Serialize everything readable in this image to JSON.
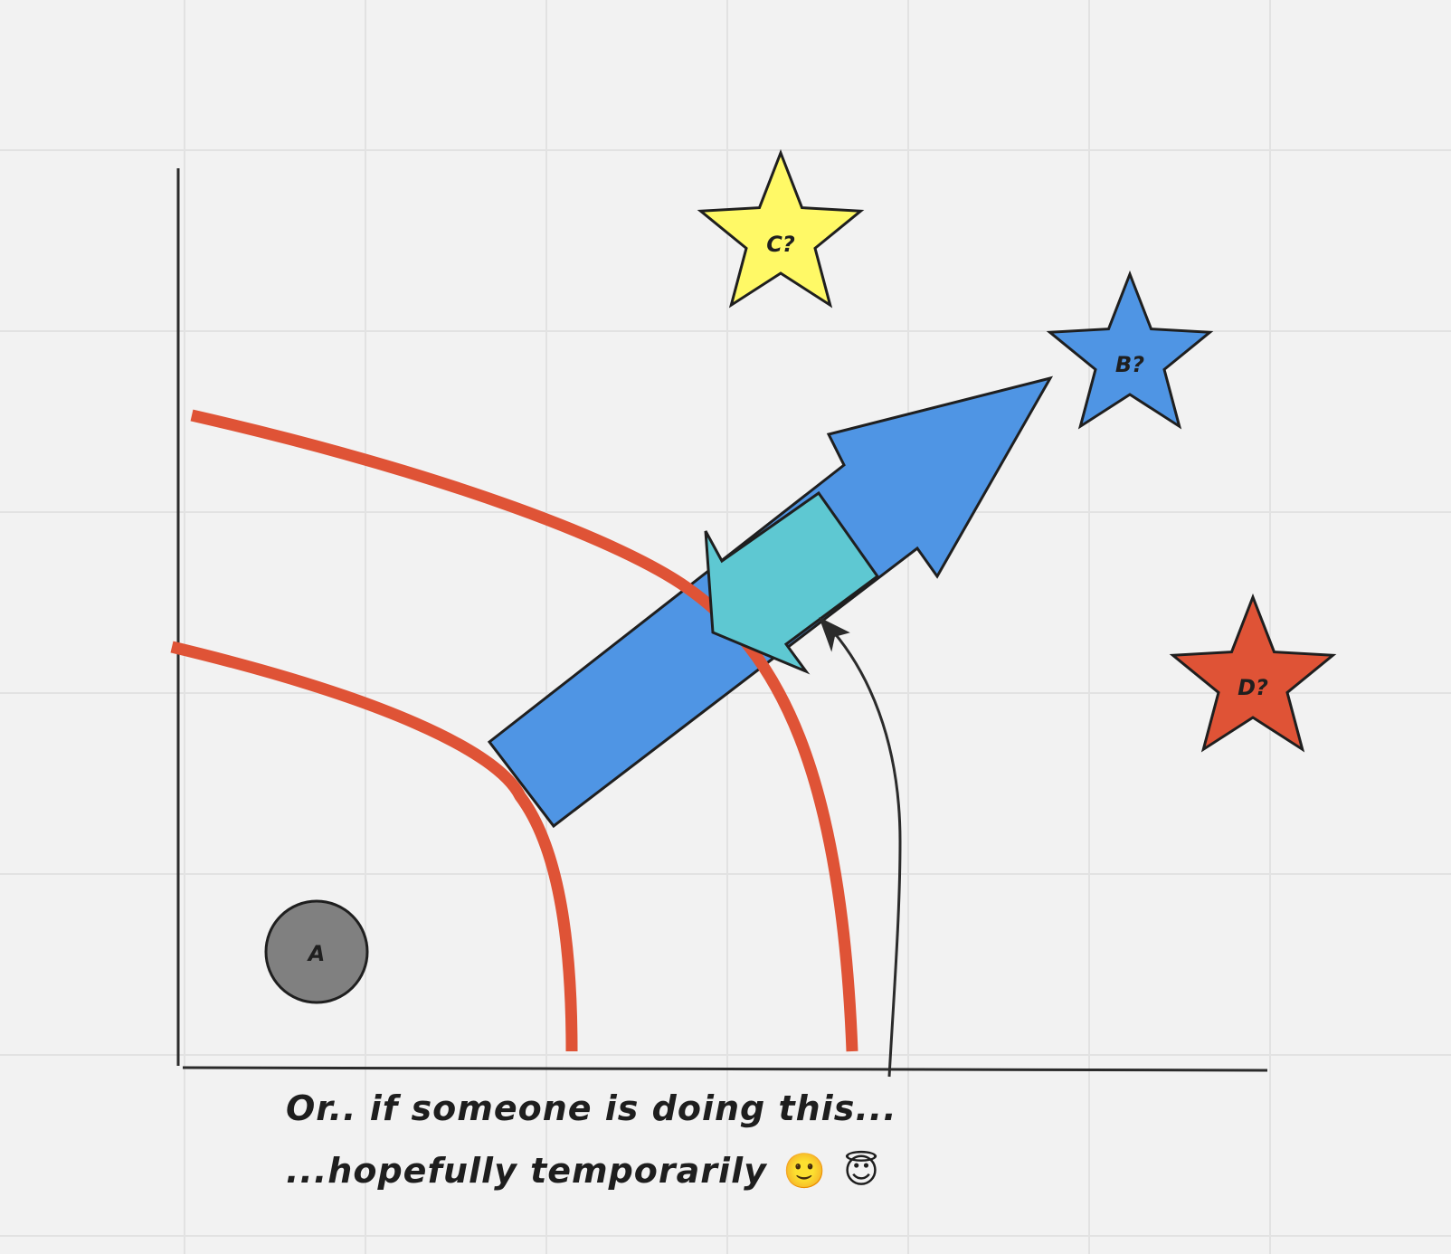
{
  "board": {
    "background_color": "#f2f2f2",
    "grid_color": "#e2e2e2"
  },
  "shapes": {
    "circle_a": {
      "label": "A",
      "fill": "#808080"
    },
    "star_b": {
      "label": "B?",
      "fill": "#4f95e4"
    },
    "star_c": {
      "label": "C?",
      "fill": "#fff966"
    },
    "star_d": {
      "label": "D?",
      "fill": "#df5336"
    }
  },
  "arrows": {
    "big_arrow_color": "#4f95e4",
    "reverse_arrow_color": "#5ec8d2",
    "curve_color": "#df5336",
    "pointer_arrow_color": "#2b2b2b"
  },
  "caption": {
    "line1": "Or.. if someone is doing this...",
    "line2": "...hopefully temporarily",
    "emoji1": "🙂",
    "emoji2": "😇"
  }
}
